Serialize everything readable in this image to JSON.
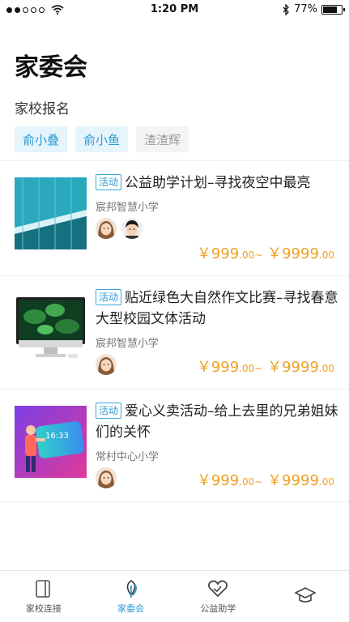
{
  "status_bar": {
    "time": "1:20 PM",
    "battery": "77%",
    "battery_level": 0.77
  },
  "page_title": "家委会",
  "section_label": "家校报名",
  "children": [
    {
      "label": "俞小叠",
      "selected": true
    },
    {
      "label": "俞小鱼",
      "selected": true
    },
    {
      "label": "渣渣辉",
      "selected": false
    }
  ],
  "activities": [
    {
      "tag": "活动",
      "title": "公益助学计划–寻找夜空中最亮",
      "school": "宸邦智慧小学",
      "price_low": "￥999",
      "price_low_dec": ".00~",
      "price_high": "￥9999",
      "price_high_dec": ".00",
      "avatars": [
        "girl",
        "boy"
      ]
    },
    {
      "tag": "活动",
      "title": "贴近绿色大自然作文比赛–寻找春意大型校园文体活动",
      "school": "宸邦智慧小学",
      "price_low": "￥999",
      "price_low_dec": ".00~",
      "price_high": "￥9999",
      "price_high_dec": ".00",
      "avatars": [
        "girl"
      ]
    },
    {
      "tag": "活动",
      "title": "爱心义卖活动–给上去里的兄弟姐妹们的关怀",
      "school": "常村中心小学",
      "price_low": "￥999",
      "price_low_dec": ".00~",
      "price_high": "￥9999",
      "price_high_dec": ".00",
      "avatars": [
        "girl"
      ],
      "thumb_text": "16:33"
    }
  ],
  "tabbar": [
    {
      "label": "家校连接",
      "icon": "tablet-icon",
      "active": false
    },
    {
      "label": "家委会",
      "icon": "leaf-icon",
      "active": true
    },
    {
      "label": "公益助学",
      "icon": "heart-icon",
      "active": false
    },
    {
      "label": "",
      "icon": "cap-icon",
      "active": false
    }
  ],
  "colors": {
    "accent": "#2b9bd3",
    "price": "#f0a020",
    "chip_bg": "#e6f4fb"
  }
}
